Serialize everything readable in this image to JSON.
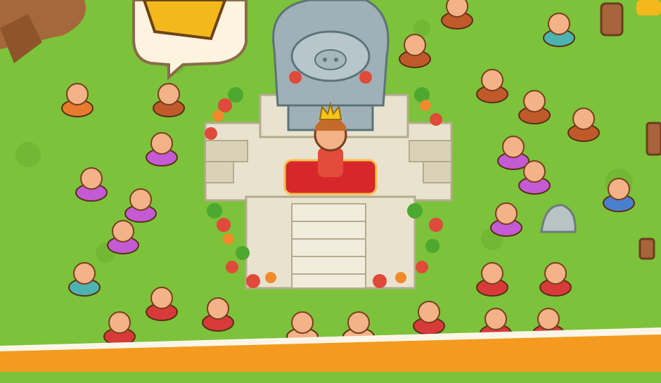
{
  "palette": {
    "grass": "#7cc23a",
    "grass_dark": "#5fa62b",
    "stone": "#e8e2cf",
    "stone_shadow": "#cfc7ad",
    "statue": "#9fb1b6",
    "carpet": "#d8272b",
    "banner": "#f39a1f",
    "skin": "#f3b287",
    "pink_shirt": "#c45ad4",
    "red_pants": "#d83a3a",
    "leaf": "#4da82f"
  },
  "icons": {
    "crown": "crown-icon",
    "speech_bubble": "speech-bubble-icon",
    "statue": "statue-icon",
    "king": "king-character",
    "villager": "villager-character"
  },
  "banner": {
    "text": ""
  }
}
